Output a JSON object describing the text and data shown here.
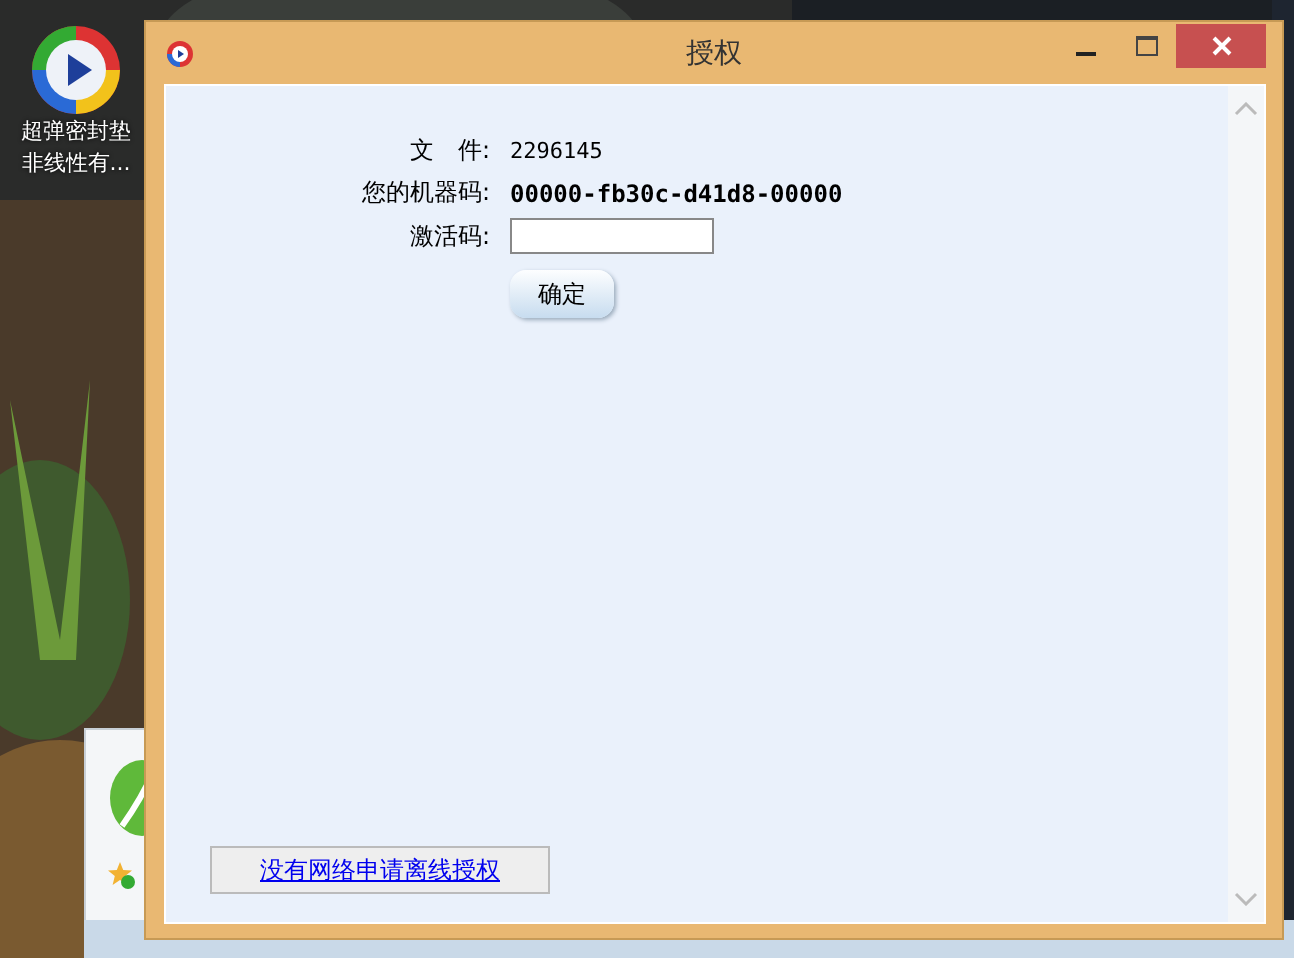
{
  "desktop_icon": {
    "label_lines": [
      "超弹密封垫",
      "非线性有..."
    ]
  },
  "dialog": {
    "title": "授权",
    "fields": [
      {
        "kind": "text",
        "label": "文　件:",
        "value": "2296145"
      },
      {
        "kind": "bold",
        "label": "您的机器码:",
        "value": "00000-fb30c-d41d8-00000"
      },
      {
        "kind": "input",
        "label": "激活码:"
      }
    ],
    "confirm_button": "确定",
    "offline_link": "没有网络申请离线授权"
  }
}
